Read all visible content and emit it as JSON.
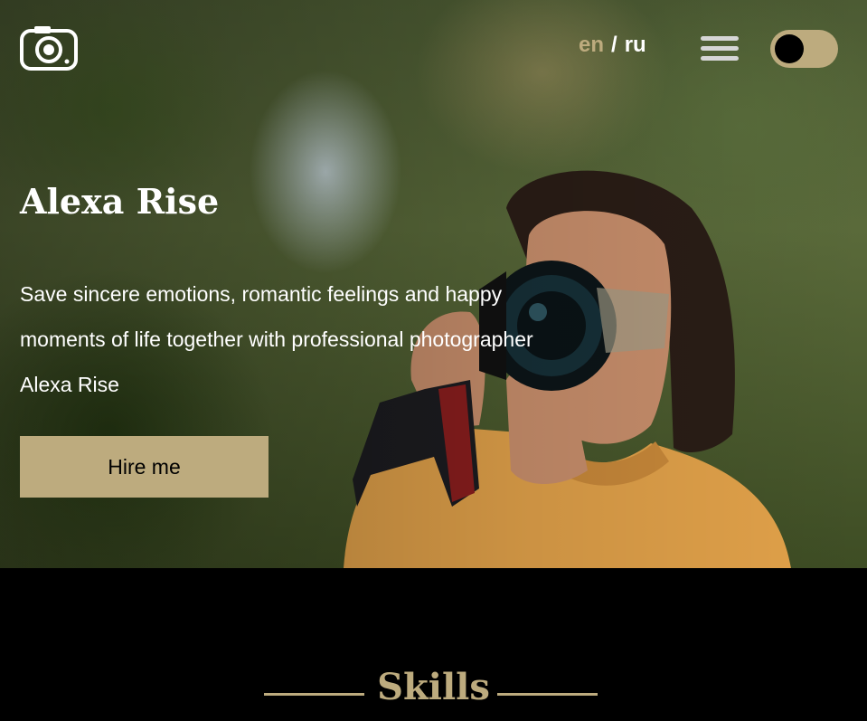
{
  "header": {
    "logo_icon": "camera-icon",
    "lang_en": "en",
    "lang_separator": "/",
    "lang_ru": "ru",
    "menu_icon": "hamburger-icon",
    "theme_toggle_icon": "toggle-icon"
  },
  "hero": {
    "title": "Alexa Rise",
    "description": "Save sincere emotions, romantic feelings and happy moments of life together with professional photographer Alexa Rise",
    "button_label": "Hire me"
  },
  "skills": {
    "heading": "Skills"
  },
  "colors": {
    "accent": "#bdab7e",
    "background": "#000000",
    "text": "#ffffff"
  }
}
